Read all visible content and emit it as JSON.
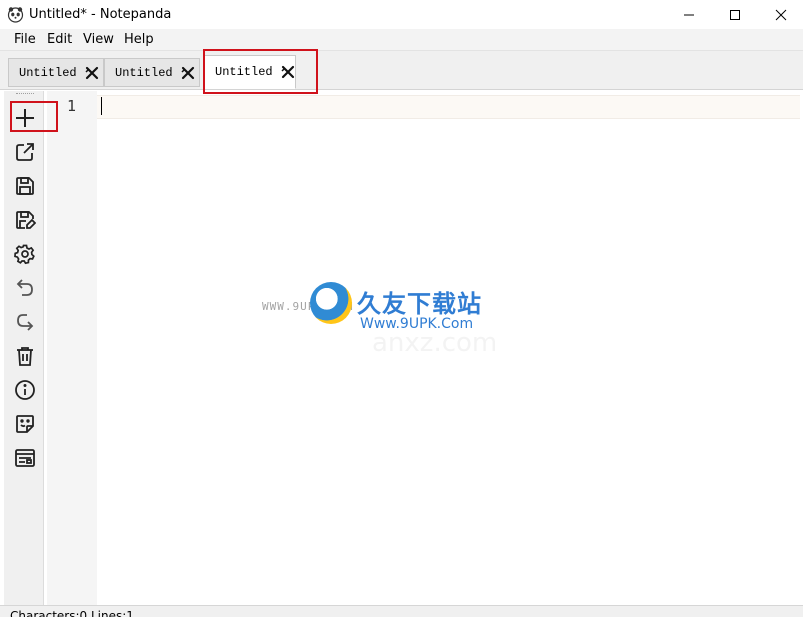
{
  "window": {
    "title": "Untitled* - Notepanda",
    "app_icon": "panda-icon",
    "controls": [
      "minimize-icon",
      "maximize-icon",
      "close-icon"
    ]
  },
  "menu": {
    "items": [
      {
        "label": "File"
      },
      {
        "label": "Edit"
      },
      {
        "label": "View"
      },
      {
        "label": "Help"
      }
    ]
  },
  "tabs": [
    {
      "label": "Untitled",
      "close_icon": "close-x-icon",
      "active": false
    },
    {
      "label": "Untitled",
      "close_icon": "close-x-icon",
      "active": false
    },
    {
      "label": "Untitled",
      "close_icon": "close-x-icon",
      "active": true
    }
  ],
  "toolbar": {
    "buttons": [
      {
        "name": "new-file-button",
        "icon": "plus-icon"
      },
      {
        "name": "open-file-button",
        "icon": "external-link-icon"
      },
      {
        "name": "save-button",
        "icon": "save-icon"
      },
      {
        "name": "save-as-button",
        "icon": "save-edit-icon"
      },
      {
        "name": "settings-button",
        "icon": "gear-icon"
      },
      {
        "name": "undo-button",
        "icon": "undo-icon"
      },
      {
        "name": "redo-button",
        "icon": "redo-icon"
      },
      {
        "name": "clear-button",
        "icon": "trash-icon"
      },
      {
        "name": "about-button",
        "icon": "info-icon"
      },
      {
        "name": "sticky-note-button",
        "icon": "sticky-note-icon"
      },
      {
        "name": "preview-button",
        "icon": "layout-icon"
      }
    ]
  },
  "editor": {
    "line_numbers": [
      "1"
    ],
    "content": ""
  },
  "watermark": {
    "small_site": "WWW.9UPK.COM",
    "brand_cn": "久友下载站",
    "url": "Www.9UPK.Com",
    "ghost": "anxz.com"
  },
  "status": {
    "text": "Characters:0 Lines:1"
  },
  "colors": {
    "highlight_box": "#d0121b",
    "accent_blue": "#1a6fcf"
  }
}
